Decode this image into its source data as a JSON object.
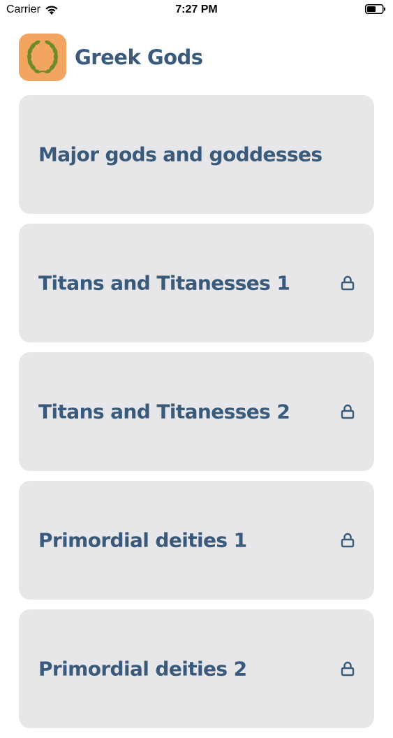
{
  "status_bar": {
    "carrier": "Carrier",
    "time": "7:27 PM",
    "icons": [
      "wifi-icon",
      "battery-icon"
    ]
  },
  "header": {
    "title": "Greek Gods",
    "icon": "laurel-wreath-icon",
    "icon_bg": "#f2a55f"
  },
  "categories": [
    {
      "label": "Major gods and goddesses",
      "locked": false
    },
    {
      "label": "Titans and Titanesses 1",
      "locked": true
    },
    {
      "label": "Titans and Titanesses 2",
      "locked": true
    },
    {
      "label": "Primordial deities 1",
      "locked": true
    },
    {
      "label": "Primordial deities 2",
      "locked": true
    }
  ],
  "colors": {
    "text": "#3a5a7c",
    "card": "#e7e6e9"
  }
}
